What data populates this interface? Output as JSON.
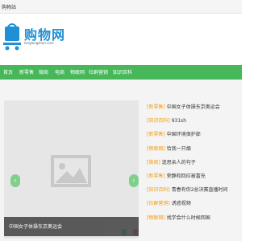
{
  "topbar": {
    "text": "购物站"
  },
  "logo": {
    "name": "购物网",
    "domain": "longlongzhan.com"
  },
  "nav": {
    "items": [
      "首页",
      "新零售",
      "微商",
      "电商",
      "物联网",
      "社群营销",
      "知识百科"
    ]
  },
  "slider": {
    "caption": "中国女子体操东京奥运会",
    "dot_colors": [
      "#2ecc40",
      "#ffffff",
      "#e74c3c"
    ]
  },
  "news": [
    {
      "category": "[新零售]",
      "title": "中国女子体操东京奥运会"
    },
    {
      "category": "[知识百科]",
      "title": "931sh"
    },
    {
      "category": "[新零售]",
      "title": "中国环境保护部"
    },
    {
      "category": "[物联网]",
      "title": "恰我一只烟"
    },
    {
      "category": "[微商]",
      "title": "追思亲人的句子"
    },
    {
      "category": "[新零售]",
      "title": "荣静和回应被富充"
    },
    {
      "category": "[知识百科]",
      "title": "青春有你2总决赛直播时间"
    },
    {
      "category": "[社群营销]",
      "title": "诱惑视频"
    },
    {
      "category": "[物联网]",
      "title": "找学会什么时候回国"
    }
  ],
  "colors": {
    "nav_bg": "#46b85a",
    "category": "#f39c12"
  }
}
